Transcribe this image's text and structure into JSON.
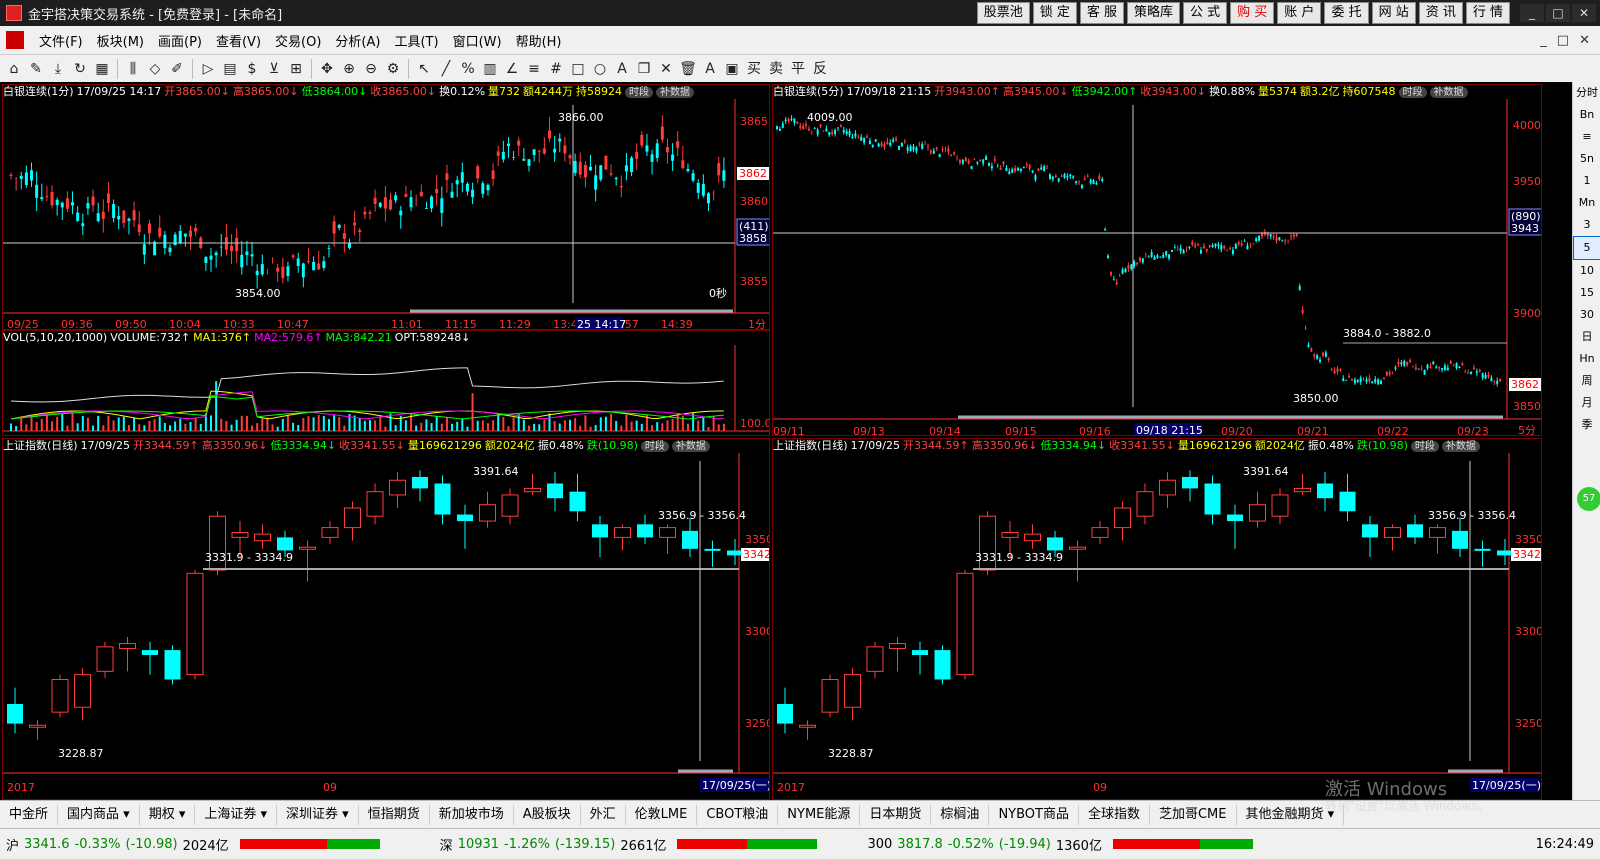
{
  "titlebar": {
    "title": "金宇搭决策交易系统 - [免费登录] - [未命名]",
    "buttons": [
      "股票池",
      "锁 定",
      "客 服",
      "策略库",
      "公 式",
      "购 买",
      "账 户",
      "委 托",
      "网 站",
      "资 讯",
      "行 情"
    ],
    "window_controls": [
      "_",
      "□",
      "✕"
    ]
  },
  "menubar": {
    "items": [
      "文件(F)",
      "板块(M)",
      "画面(P)",
      "查看(V)",
      "交易(O)",
      "分析(A)",
      "工具(T)",
      "窗口(W)",
      "帮助(H)"
    ],
    "right": [
      "_",
      "□",
      "✕"
    ]
  },
  "toolbar": {
    "icons": [
      "home-icon",
      "pencil-icon",
      "download-icon",
      "refresh-icon",
      "grid-icon",
      "candle-icon",
      "diamond-icon",
      "edit-icon",
      "play-icon",
      "note-icon",
      "dollar-icon",
      "filter-icon",
      "f10-icon",
      "move-icon",
      "zoom-in-icon",
      "zoom-out-icon",
      "settings-icon",
      "cursor-icon",
      "line-icon",
      "percent-icon",
      "ruler-icon",
      "angle-icon",
      "hlines-icon",
      "grid2-icon",
      "rect-icon",
      "circle-icon",
      "text-icon",
      "copy-icon",
      "delete-icon",
      "trash-icon",
      "font-color-icon",
      "save-icon",
      "buy-icon",
      "sell-icon",
      "flat-icon",
      "reverse-icon"
    ],
    "glyphs": [
      "⌂",
      "✎",
      "⤓",
      "↻",
      "▦",
      "⫼",
      "◇",
      "✐",
      "▷",
      "▤",
      "$",
      "⊻",
      "⊞",
      "✥",
      "⊕",
      "⊖",
      "⚙",
      "↖",
      "╱",
      "%",
      "▥",
      "∠",
      "≡",
      "#",
      "□",
      "○",
      "A",
      "❐",
      "✕",
      "🗑",
      "A",
      "▣",
      "买",
      "卖",
      "平",
      "反"
    ]
  },
  "panels": {
    "p1": {
      "header": [
        {
          "t": "白银连续(1分)",
          "c": "name"
        },
        {
          "t": "17/09/25 14:17",
          "c": "name"
        },
        {
          "t": "开3865.00↓",
          "c": "red"
        },
        {
          "t": "高3865.00↓",
          "c": "red"
        },
        {
          "t": "低3864.00↓",
          "c": "grn"
        },
        {
          "t": "收3865.00↓",
          "c": "red"
        },
        {
          "t": "换0.12%",
          "c": "name"
        },
        {
          "t": "量732",
          "c": "yel"
        },
        {
          "t": "额4244万",
          "c": "yel"
        },
        {
          "t": "持58924",
          "c": "yel"
        }
      ],
      "tags": [
        "时段",
        "补数据"
      ],
      "price_labels": [
        "3865",
        "3862",
        "3860",
        "3858",
        "3855"
      ],
      "price_badge": "3862",
      "cursor_badge_top": "(411)",
      "cursor_badge": "3858",
      "annot_high": "3866.00",
      "annot_low": "3854.00",
      "seconds": "0秒",
      "time_labels": [
        "09/25",
        "09:36",
        "09:50",
        "10:04",
        "10:33",
        "10:47",
        "11:01",
        "11:15",
        "11:29",
        "13:43",
        "13:57",
        "14:39"
      ],
      "time_cursor": "25 14:17",
      "period": "1分"
    },
    "vol": {
      "header": [
        {
          "t": "VOL(5,10,20,1000)",
          "c": "name"
        },
        {
          "t": "VOLUME:732↑",
          "c": "name"
        },
        {
          "t": "MA1:376↑",
          "c": "yel"
        },
        {
          "t": "MA2:579.6↑",
          "c": "mag"
        },
        {
          "t": "MA3:842.21",
          "c": "grn"
        },
        {
          "t": "OPT:589248↓",
          "c": "name"
        }
      ],
      "axis_label": "100.0"
    },
    "p2": {
      "header": [
        {
          "t": "白银连续(5分)",
          "c": "name"
        },
        {
          "t": "17/09/18 21:15",
          "c": "name"
        },
        {
          "t": "开3943.00↑",
          "c": "red"
        },
        {
          "t": "高3945.00↓",
          "c": "red"
        },
        {
          "t": "低3942.00↑",
          "c": "grn"
        },
        {
          "t": "收3943.00↓",
          "c": "red"
        },
        {
          "t": "换0.88%",
          "c": "name"
        },
        {
          "t": "量5374",
          "c": "yel"
        },
        {
          "t": "额3.2亿",
          "c": "yel"
        },
        {
          "t": "持607548",
          "c": "yel"
        }
      ],
      "tags": [
        "时段",
        "补数据"
      ],
      "price_labels": [
        "4000",
        "3950",
        "3900",
        "3862",
        "3850"
      ],
      "price_badge": "3862",
      "cursor_badge_top": "(890)",
      "cursor_badge": "3943",
      "annot_high": "4009.00",
      "annot_mid": "3884.0 - 3882.0",
      "annot_low": "3850.00",
      "time_labels": [
        "09/11",
        "09/13",
        "09/14",
        "09/15",
        "09/16",
        "09/20",
        "09/21",
        "09/22",
        "09/23"
      ],
      "time_cursor": "09/18 21:15",
      "period": "5分"
    },
    "p3": {
      "header": [
        {
          "t": "上证指数(日线)",
          "c": "name"
        },
        {
          "t": "17/09/25",
          "c": "name"
        },
        {
          "t": "开3344.59↑",
          "c": "red"
        },
        {
          "t": "高3350.96↓",
          "c": "red"
        },
        {
          "t": "低3334.94↓",
          "c": "grn"
        },
        {
          "t": "收3341.55↓",
          "c": "red"
        },
        {
          "t": "量169621296",
          "c": "yel"
        },
        {
          "t": "额2024亿",
          "c": "yel"
        },
        {
          "t": "振0.48%",
          "c": "name"
        },
        {
          "t": "跌(10.98)",
          "c": "grn"
        }
      ],
      "tags": [
        "时段",
        "补数据"
      ],
      "price_labels": [
        "3350",
        "3300",
        "3250"
      ],
      "price_badge": "3342",
      "annot_high": "3391.64",
      "annot_mid": "3331.9 - 3334.9",
      "annot_right": "3356.9 - 3356.4",
      "annot_low": "3228.87",
      "time_labels": [
        "2017",
        "09"
      ],
      "time_cursor": "17/09/25(一)"
    },
    "p4": {
      "header": [
        {
          "t": "上证指数(日线)",
          "c": "name"
        },
        {
          "t": "17/09/25",
          "c": "name"
        },
        {
          "t": "开3344.59↑",
          "c": "red"
        },
        {
          "t": "高3350.96↓",
          "c": "red"
        },
        {
          "t": "低3334.94↓",
          "c": "grn"
        },
        {
          "t": "收3341.55↓",
          "c": "red"
        },
        {
          "t": "量169621296",
          "c": "yel"
        },
        {
          "t": "额2024亿",
          "c": "yel"
        },
        {
          "t": "振0.48%",
          "c": "name"
        },
        {
          "t": "跌(10.98)",
          "c": "grn"
        }
      ],
      "tags": [
        "时段",
        "补数据"
      ],
      "price_labels": [
        "3350",
        "3300",
        "3250"
      ],
      "price_badge": "3342",
      "annot_high": "3391.64",
      "annot_mid": "3331.9 - 3334.9",
      "annot_right": "3356.9 - 3356.4",
      "annot_low": "3228.87",
      "time_labels": [
        "2017",
        "09"
      ],
      "time_cursor": "17/09/25(一)"
    }
  },
  "rightbar": {
    "items": [
      "分时",
      "Bn",
      "≡",
      "5n",
      "1",
      "Mn",
      "3",
      "5",
      "10",
      "15",
      "30",
      "日",
      "Hn",
      "周",
      "月",
      "季"
    ],
    "selected": "5",
    "badge": "57"
  },
  "tabbar": {
    "tabs": [
      "中金所",
      "国内商品 ▾",
      "期权 ▾",
      "上海证券 ▾",
      "深圳证券 ▾",
      "恒指期货",
      "新加坡市场",
      "A股板块",
      "外汇",
      "伦敦LME",
      "CBOT粮油",
      "NYME能源",
      "日本期货",
      "棕榈油",
      "NYBOT商品",
      "全球指数",
      "芝加哥CME",
      "其他金融期货 ▾"
    ]
  },
  "statusbar": {
    "sh_label": "沪",
    "sh_value": "3341.6",
    "sh_change": "-0.33%",
    "sh_points": "(-10.98)",
    "sh_amount": "2024亿",
    "sz_label": "深",
    "sz_value": "10931",
    "sz_change": "-1.26%",
    "sz_points": "(-139.15)",
    "sz_amount": "2661亿",
    "hs_label": "300",
    "hs_value": "3817.8",
    "hs_change": "-0.52%",
    "hs_points": "(-19.94)",
    "hs_amount": "1360亿",
    "clock": "16:24:49"
  },
  "watermark": {
    "line1": "激活 Windows",
    "line2": "转到\"设置\"以激活 Windows。"
  },
  "colors": {
    "up": "#ff3c3c",
    "down": "#00ffff",
    "axis": "#ff3030",
    "border": "#800000"
  }
}
